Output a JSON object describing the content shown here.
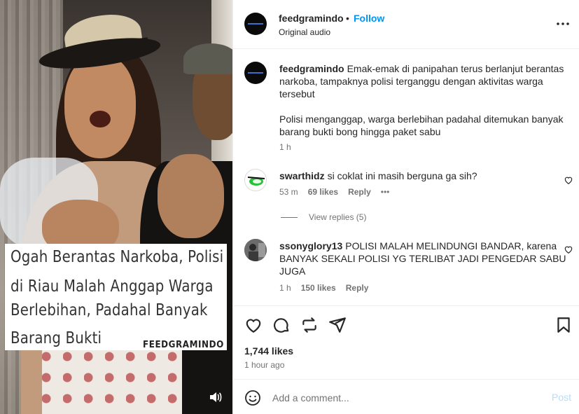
{
  "post": {
    "media": {
      "caption_lines": [
        "Ogah Berantas Narkoba, Polisi",
        "di Riau Malah Anggap Warga",
        "Berlebihan, Padahal Banyak",
        "Barang Bukti"
      ],
      "brand": "FEEDGRAMINDO",
      "audio_icon": "speaker-icon"
    },
    "header": {
      "username": "feedgramindo",
      "separator": "•",
      "follow_label": "Follow",
      "subtitle": "Original audio",
      "more_icon": "more-options-icon"
    },
    "caption": {
      "username": "feedgramindo",
      "text": "Emak-emak di panipahan terus berlanjut berantas narkoba, tampaknya polisi terganggu dengan aktivitas warga tersebut",
      "text2": "Polisi menganggap, warga berlebihan padahal ditemukan banyak barang bukti bong hingga paket sabu",
      "time": "1 h"
    },
    "comments": [
      {
        "username": "swarthidz",
        "text": "si coklat ini masih berguna ga sih?",
        "time": "53 m",
        "likes": "69 likes",
        "reply_label": "Reply",
        "more": "•••",
        "view_replies": "View replies (5)"
      },
      {
        "username": "ssonyglory13",
        "text": "POLISI MALAH MELINDUNGI BANDAR, karena BANYAK SEKALI POLISI YG TERLIBAT JADI PENGEDAR SABU JUGA",
        "time": "1 h",
        "likes": "150 likes",
        "reply_label": "Reply"
      }
    ],
    "actions": {
      "icons": [
        "heart-icon",
        "comment-icon",
        "repost-icon",
        "share-icon",
        "bookmark-icon"
      ],
      "likes": "1,744 likes",
      "time_ago": "1 hour ago"
    },
    "add_comment": {
      "placeholder": "Add a comment...",
      "post_label": "Post",
      "emoji_icon": "emoji-icon"
    },
    "colors": {
      "link_blue": "#0095f6",
      "post_disabled": "#b2dffc",
      "text": "#262626",
      "muted": "#737373"
    }
  }
}
